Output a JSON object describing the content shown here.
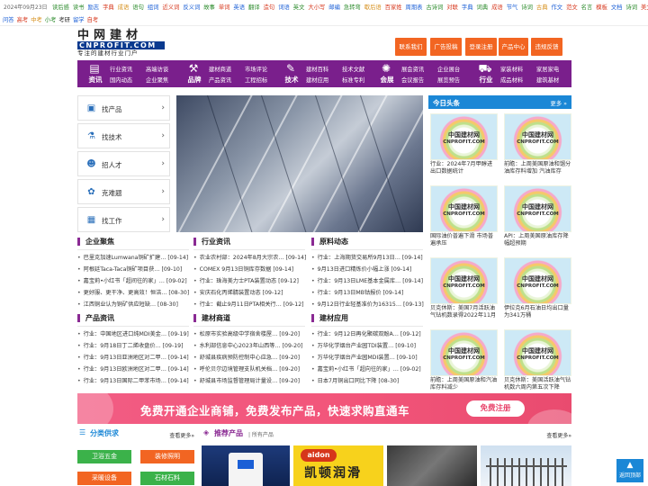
{
  "topbar": {
    "date": "2024年09月23日",
    "links": [
      {
        "label": "读后感",
        "color": "#2a8a2a"
      },
      {
        "label": "读书",
        "color": "#2a8a2a"
      },
      {
        "label": "励志",
        "color": "#1b5fd6"
      },
      {
        "label": "字典",
        "color": "#d6361b"
      },
      {
        "label": "成语",
        "color": "#d68f1b"
      },
      {
        "label": "语句",
        "color": "#2a8a2a"
      },
      {
        "label": "组词",
        "color": "#1b5fd6"
      },
      {
        "label": "近义词",
        "color": "#d6361b"
      },
      {
        "label": "反义词",
        "color": "#1b5fd6"
      },
      {
        "label": "故事",
        "color": "#2a8a2a"
      },
      {
        "label": "单词",
        "color": "#d6361b"
      },
      {
        "label": "英语",
        "color": "#1b5fd6"
      },
      {
        "label": "翻译",
        "color": "#2a8a2a"
      },
      {
        "label": "造句",
        "color": "#d6361b"
      },
      {
        "label": "词语",
        "color": "#1b5fd6"
      },
      {
        "label": "英文",
        "color": "#2a8a2a"
      },
      {
        "label": "大小写",
        "color": "#d6361b"
      },
      {
        "label": "邮编",
        "color": "#1b5fd6"
      },
      {
        "label": "急转弯",
        "color": "#2a8a2a"
      },
      {
        "label": "歇后语",
        "color": "#d68f1b"
      },
      {
        "label": "百家姓",
        "color": "#d6361b"
      },
      {
        "label": "周期表",
        "color": "#1b5fd6"
      },
      {
        "label": "古诗词",
        "color": "#2a8a2a"
      },
      {
        "label": "对联",
        "color": "#d6361b"
      },
      {
        "label": "字典",
        "color": "#1b5fd6"
      },
      {
        "label": "词典",
        "color": "#2a8a2a"
      },
      {
        "label": "成语",
        "color": "#d6361b"
      },
      {
        "label": "节气",
        "color": "#1b5fd6"
      },
      {
        "label": "诗词",
        "color": "#2a8a2a"
      },
      {
        "label": "古典",
        "color": "#d68f1b"
      },
      {
        "label": "作文",
        "color": "#1b5fd6"
      },
      {
        "label": "范文",
        "color": "#d6361b"
      },
      {
        "label": "名言",
        "color": "#2a8a2a"
      },
      {
        "label": "模板",
        "color": "#d6361b"
      },
      {
        "label": "文档",
        "color": "#1b5fd6"
      },
      {
        "label": "诗词",
        "color": "#2a8a2a"
      },
      {
        "label": "美文",
        "color": "#d6361b"
      },
      {
        "label": "教育",
        "color": "#1b5fd6"
      }
    ]
  },
  "secrow": [
    {
      "label": "问答",
      "color": "#1b5fd6"
    },
    {
      "label": "高考",
      "color": "#d6361b"
    },
    {
      "label": "中考",
      "color": "#d68f1b"
    },
    {
      "label": "小考",
      "color": "#2a8a2a"
    },
    {
      "label": "考研",
      "color": "#333333"
    },
    {
      "label": "留学",
      "color": "#1b5fd6"
    },
    {
      "label": "自考",
      "color": "#d6361b"
    }
  ],
  "logo": {
    "cn": "中网建材",
    "en": "CNPROFIT.COM",
    "slogan": "专注的建材行业门户"
  },
  "header_buttons": [
    "联系我们",
    "广告投稿",
    "登录注册",
    "产品中心",
    "违规反馈"
  ],
  "nav": [
    {
      "title": "资讯",
      "icon": "newspaper-icon",
      "glyph": "▤",
      "links": [
        "行业资讯",
        "高端访谈",
        "国内动态",
        "企业聚焦"
      ]
    },
    {
      "title": "品牌",
      "icon": "hammer-icon",
      "glyph": "⚒",
      "links": [
        "建材商道",
        "市场评论",
        "产品资讯",
        "工程招标"
      ]
    },
    {
      "title": "技术",
      "icon": "wrench-icon",
      "glyph": "✎",
      "links": [
        "建材百科",
        "技术文献",
        "建材应用",
        "标准专利"
      ]
    },
    {
      "title": "会展",
      "icon": "network-icon",
      "glyph": "✺",
      "links": [
        "展会资讯",
        "企业展台",
        "会议报告",
        "展览预告"
      ]
    },
    {
      "title": "行业",
      "icon": "cart-icon",
      "glyph": "⛟",
      "links": [
        "家装材料",
        "家居家电",
        "成品材料",
        "建筑基材"
      ]
    }
  ],
  "left_menu": [
    {
      "label": "找产品",
      "icon": "box-icon",
      "glyph": "▣"
    },
    {
      "label": "找技术",
      "icon": "flask-icon",
      "glyph": "⚗"
    },
    {
      "label": "招人才",
      "icon": "person-icon",
      "glyph": "☻"
    },
    {
      "label": "克难题",
      "icon": "puzzle-icon",
      "glyph": "✿"
    },
    {
      "label": "找工作",
      "icon": "briefcase-icon",
      "glyph": "▦"
    }
  ],
  "right_panel": {
    "title": "今日头条",
    "more": "更多 »",
    "cards": [
      {
        "cn": "中国建材网",
        "en": "CNPROFIT.COM",
        "caption": "行业：2024年7月甲醇进出口数据统计"
      },
      {
        "cn": "中国建材网",
        "en": "CNPROFIT.COM",
        "caption": "前瞻：上周美国原油和馏分油库存料增加 汽油库存"
      },
      {
        "cn": "中国建材网",
        "en": "CNPROFIT.COM",
        "caption": "国际油价普遍下滑 市场普遍承压"
      },
      {
        "cn": "中国建材网",
        "en": "CNPROFIT.COM",
        "caption": "API：上周美国原油库存降幅超预期"
      },
      {
        "cn": "中国建材网",
        "en": "CNPROFIT.COM",
        "caption": "贝克休斯：美国7月活跃油气钻机数录得2022年11月"
      },
      {
        "cn": "中国建材网",
        "en": "CNPROFIT.COM",
        "caption": "伊拉克6月石油日均出口量为341万桶"
      },
      {
        "cn": "中国建材网",
        "en": "CNPROFIT.COM",
        "caption": "前瞻：上周美国原油和汽油库存料减少"
      },
      {
        "cn": "中国建材网",
        "en": "CNPROFIT.COM",
        "caption": "贝克休斯：美国活跃油气钻机数六周内第五次下降"
      }
    ]
  },
  "news_sections": [
    {
      "title": "企业聚焦",
      "items": [
        "巴里克加速Lumwana铜矿扩建… [09-14]",
        "阿根廷Taca-Taca铜矿项目获… [09-10]",
        "嘉宝莉•小红书「超间往的家」… [09-02]",
        "更好服、更干净、更高效！恒洁… [08-30]",
        "江西铜业认为铜矿供应短缺… [08-30]"
      ]
    },
    {
      "title": "行业资讯",
      "items": [
        "农业农村部：2024年8月大宗农… [09-14]",
        "COMEX 9月13日铜库存数据 [09-14]",
        "行业：珠海美力士PTA装置动态 [09-12]",
        "安庆石化丙烯腈装置动态 [09-12]",
        "行业：截止9月11日PTA相关行… [09-12]"
      ]
    },
    {
      "title": "原料动态",
      "items": [
        "行业：上海期货交易所9月13日… [09-14]",
        "9月13日进口精炼价小幅上涨 [09-14]",
        "行业：9月13日LME基本金属库… [09-14]",
        "行业：9月13日MB钴报价 [09-14]",
        "9月12日行业轻基准价为16315… [09-13]"
      ]
    },
    {
      "title": "产品资讯",
      "items": [
        "行业：中国地区进口纯MDI美金… [09-19]",
        "行业：9月18日丁二烯收盘价… [09-19]",
        "行业：9月13日亚洲地区对二甲… [09-14]",
        "行业：9月13日欧洲地区对二甲… [09-14]",
        "行业：9月13日国际二甲苯市场… [09-14]"
      ]
    },
    {
      "title": "建材商道",
      "items": [
        "松原市实验高级中学宿舍楼屋… [09-20]",
        "水利部信息中心2023年山西等… [09-20]",
        "舒城县疾病预防控制中心应急… [09-20]",
        "呼伦贝尔边境管理支队机关档… [09-20]",
        "舒城县市场监督管理局计量设… [09-20]"
      ]
    },
    {
      "title": "建材应用",
      "items": [
        "行业：9月12日再化聚碳双酚A… [09-12]",
        "万华化学烟台产业园TDI装置… [09-10]",
        "万华化学烟台产业园MDI装置… [09-10]",
        "嘉宝莉•小红书「超向往的家」… [09-02]",
        "日本7月铜出口同比下降 [08-30]"
      ]
    }
  ],
  "ad_banner": {
    "text": "免费开通企业商铺，免费发布产品，快速求购直通车",
    "button": "免费注册"
  },
  "category": {
    "title": "分类供求",
    "more": "查看更多»",
    "buttons": [
      {
        "label": "卫浴五金",
        "color": "#3bb24a"
      },
      {
        "label": "装修照明",
        "color": "#f26522"
      },
      {
        "label": "采暖设备",
        "color": "#f26522"
      },
      {
        "label": "石材石料",
        "color": "#3bb24a"
      }
    ]
  },
  "products": {
    "title": "推荐产品",
    "subtitle": "| 所有产品",
    "more": "查看更多»",
    "items": [
      "涂料桶",
      "凯顿润滑",
      "展示图",
      "阳台栏杆"
    ]
  },
  "back_to_top": "返回顶部"
}
